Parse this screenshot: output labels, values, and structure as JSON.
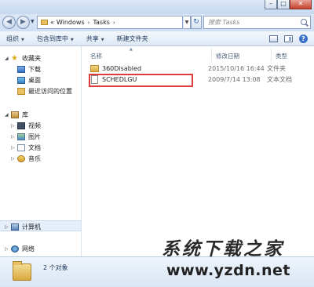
{
  "window": {
    "controls": {
      "minimize": "–",
      "maximize": "□",
      "close": "✕"
    }
  },
  "address_bar": {
    "breadcrumb_overflow": "«",
    "segments": [
      "Windows",
      "Tasks"
    ],
    "separator": "›",
    "search_placeholder": "搜索 Tasks"
  },
  "toolbar": {
    "items": [
      "组织",
      "包含到库中",
      "共享",
      "新建文件夹"
    ],
    "dropdown_arrow": "▼"
  },
  "nav_pane": {
    "favorites": {
      "label": "收藏夹",
      "items": [
        "下载",
        "桌面",
        "最近访问的位置"
      ]
    },
    "libraries": {
      "label": "库",
      "items": [
        "视频",
        "图片",
        "文档",
        "音乐"
      ]
    },
    "computer": {
      "label": "计算机"
    },
    "network": {
      "label": "网络"
    }
  },
  "file_list": {
    "columns": {
      "name": "名称",
      "date": "修改日期",
      "type": "类型"
    },
    "rows": [
      {
        "name": "360Disabled",
        "date": "2015/10/16 16:44",
        "type": "文件夹",
        "icon": "folder-icon"
      },
      {
        "name": "SCHEDLGU",
        "date": "2009/7/14 13:08",
        "type": "文本文档",
        "icon": "text-file-icon"
      }
    ],
    "highlight_color": "#e03a3a"
  },
  "status_bar": {
    "text": "2 个对象"
  },
  "watermark": {
    "chinese": "系统下载之家",
    "url": "www.yzdn.net"
  }
}
